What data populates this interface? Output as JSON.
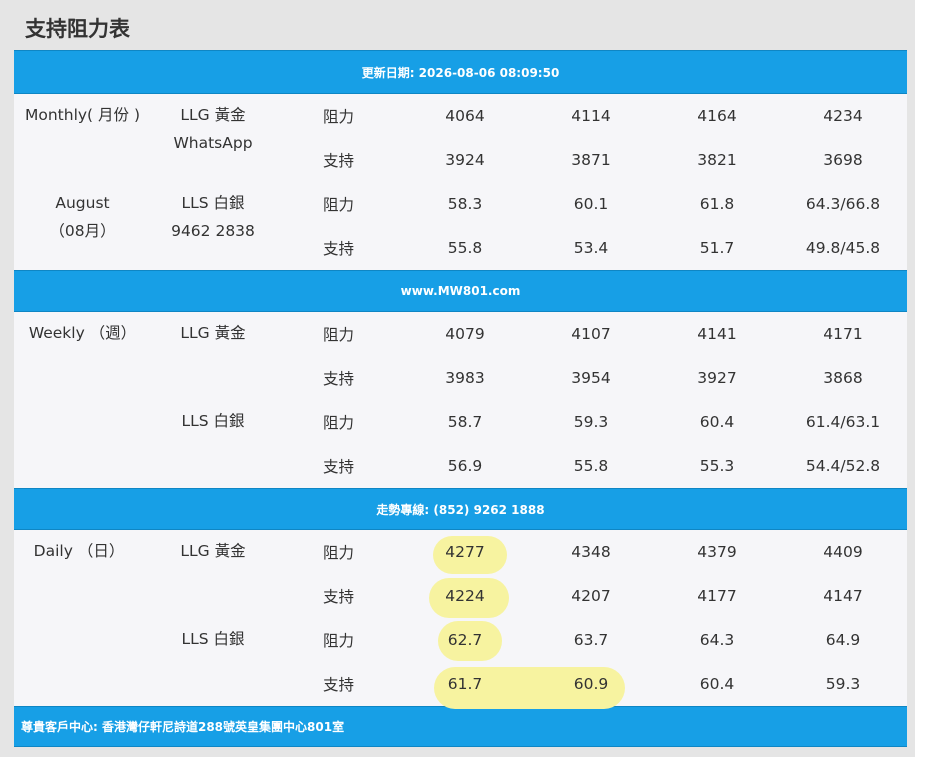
{
  "page_title": "支持阻力表",
  "banners": {
    "update": "更新日期: 2026-08-06 08:09:50",
    "website": "www.MW801.com",
    "hotline": "走勢專線: (852) 9262 1888",
    "address": "尊貴客戶中心: 香港灣仔軒尼詩道288號英皇集團中心801室"
  },
  "monthly": {
    "period_label": "Monthly( 月份 )",
    "month_name": "August",
    "month_num": "（08月）",
    "llg_label": "LLG 黃金",
    "whatsapp_label": "WhatsApp",
    "lls_label": "LLS 白銀",
    "phone": "9462 2838",
    "rows": [
      {
        "type": "阻力",
        "v1": "4064",
        "v2": "4114",
        "v3": "4164",
        "v4": "4234"
      },
      {
        "type": "支持",
        "v1": "3924",
        "v2": "3871",
        "v3": "3821",
        "v4": "3698"
      },
      {
        "type": "阻力",
        "v1": "58.3",
        "v2": "60.1",
        "v3": "61.8",
        "v4": "64.3/66.8"
      },
      {
        "type": "支持",
        "v1": "55.8",
        "v2": "53.4",
        "v3": "51.7",
        "v4": "49.8/45.8"
      }
    ]
  },
  "weekly": {
    "period_label": "Weekly （週）",
    "llg_label": "LLG 黃金",
    "lls_label": "LLS 白銀",
    "rows": [
      {
        "type": "阻力",
        "v1": "4079",
        "v2": "4107",
        "v3": "4141",
        "v4": "4171"
      },
      {
        "type": "支持",
        "v1": "3983",
        "v2": "3954",
        "v3": "3927",
        "v4": "3868"
      },
      {
        "type": "阻力",
        "v1": "58.7",
        "v2": "59.3",
        "v3": "60.4",
        "v4": "61.4/63.1"
      },
      {
        "type": "支持",
        "v1": "56.9",
        "v2": "55.8",
        "v3": "55.3",
        "v4": "54.4/52.8"
      }
    ]
  },
  "daily": {
    "period_label": "Daily （日）",
    "llg_label": "LLG 黃金",
    "lls_label": "LLS 白銀",
    "rows": [
      {
        "type": "阻力",
        "v1": "4277",
        "v2": "4348",
        "v3": "4379",
        "v4": "4409"
      },
      {
        "type": "支持",
        "v1": "4224",
        "v2": "4207",
        "v3": "4177",
        "v4": "4147"
      },
      {
        "type": "阻力",
        "v1": "62.7",
        "v2": "63.7",
        "v3": "64.3",
        "v4": "64.9"
      },
      {
        "type": "支持",
        "v1": "61.7",
        "v2": "60.9",
        "v3": "60.4",
        "v4": "59.3"
      }
    ]
  },
  "colors": {
    "banner_blue": "#179fe6",
    "highlight_yellow": "#f7f3a0",
    "panel_gray": "#e5e5e5",
    "row_bg": "#f6f6f9"
  }
}
